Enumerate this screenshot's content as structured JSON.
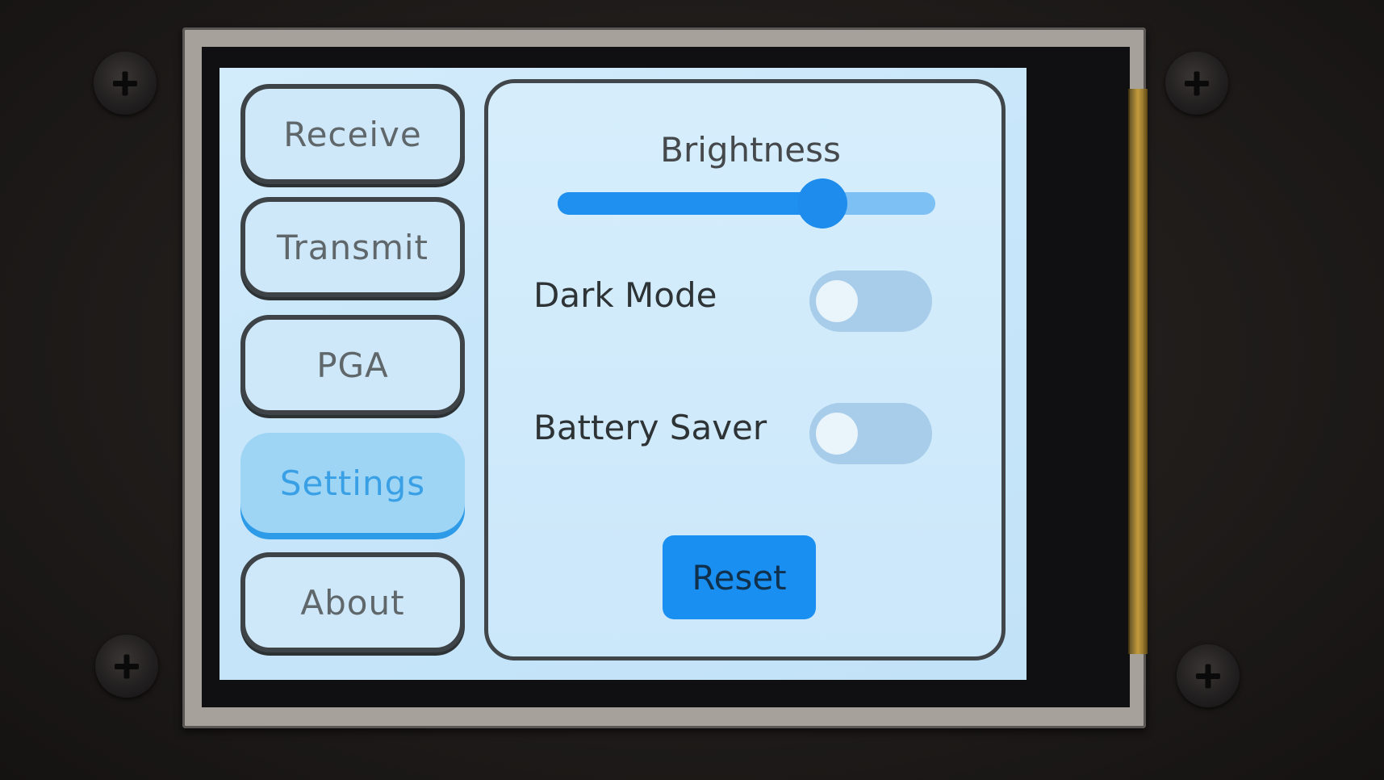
{
  "nav": {
    "items": [
      {
        "label": "Receive",
        "active": false
      },
      {
        "label": "Transmit",
        "active": false
      },
      {
        "label": "PGA",
        "active": false
      },
      {
        "label": "Settings",
        "active": true
      },
      {
        "label": "About",
        "active": false
      }
    ]
  },
  "settings": {
    "brightness": {
      "label": "Brightness",
      "value_fraction": 0.7
    },
    "dark_mode": {
      "label": "Dark Mode",
      "on": false
    },
    "battery_saver": {
      "label": "Battery Saver",
      "on": false
    },
    "reset_label": "Reset"
  },
  "colors": {
    "accent": "#1d8cec",
    "active_nav": "#9ed4f4",
    "screen_bg": "#c8e6fa"
  }
}
